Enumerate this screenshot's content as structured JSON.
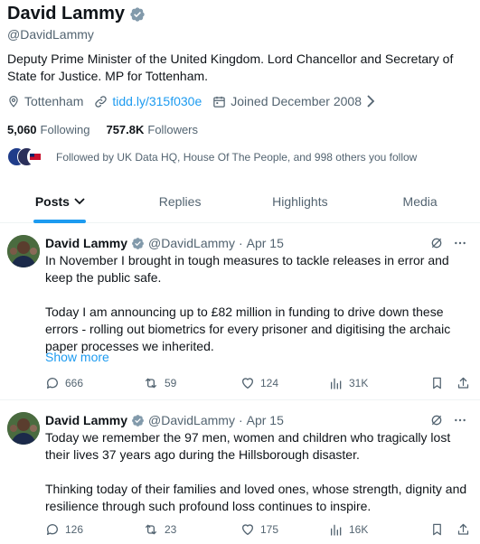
{
  "profile": {
    "name": "David Lammy",
    "handle": "@DavidLammy",
    "bio": "Deputy Prime Minister of the United Kingdom. Lord Chancellor and Secretary of State for Justice. MP for Tottenham.",
    "location": "Tottenham",
    "link": "tidd.ly/315f030e",
    "joined": "Joined December 2008",
    "following_count": "5,060",
    "following_label": "Following",
    "followers_count": "757.8K",
    "followers_label": "Followers",
    "followed_by": "Followed by UK Data HQ, House Of The People, and 998 others you follow"
  },
  "tabs": [
    {
      "label": "Posts",
      "active": true
    },
    {
      "label": "Replies"
    },
    {
      "label": "Highlights"
    },
    {
      "label": "Media"
    }
  ],
  "tweets": [
    {
      "name": "David Lammy",
      "handle": "@DavidLammy",
      "separator": "·",
      "date": "Apr 15",
      "paragraphs": [
        "In November I brought in tough measures to tackle releases in error and keep the public safe.",
        "Today I am announcing up to £82 million in funding to drive down these errors - rolling out biometrics for every prisoner and digitising the archaic paper processes we inherited."
      ],
      "show_more": "Show more",
      "replies": "666",
      "reposts": "59",
      "likes": "124",
      "views": "31K"
    },
    {
      "name": "David Lammy",
      "handle": "@DavidLammy",
      "separator": "·",
      "date": "Apr 15",
      "paragraphs": [
        "Today we remember the 97 men, women and children who tragically lost their lives 37 years ago during the Hillsborough disaster.",
        "Thinking today of their families and loved ones, whose strength, dignity and resilience through such profound loss continues to inspire."
      ],
      "replies": "126",
      "reposts": "23",
      "likes": "175",
      "views": "16K"
    }
  ],
  "colors": {
    "accent": "#1d9bf0",
    "verified_badge": "#829aab",
    "text": "#0f1419",
    "muted": "#536471"
  }
}
